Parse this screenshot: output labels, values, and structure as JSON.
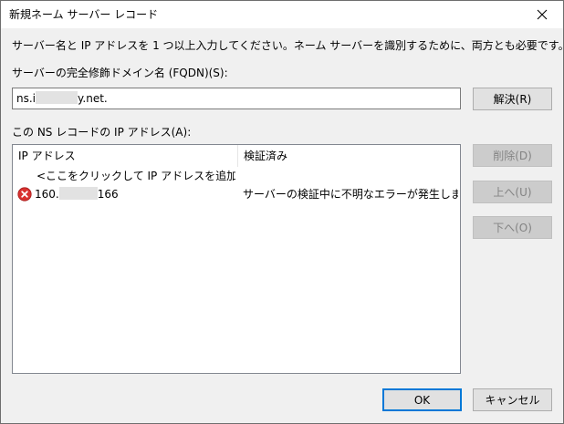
{
  "dialog": {
    "title": "新規ネーム サーバー レコード",
    "close_glyph": "✕"
  },
  "instruction": "サーバー名と IP アドレスを 1 つ以上入力してください。ネーム サーバーを識別するために、両方とも必要です。",
  "fqdn": {
    "label": "サーバーの完全修飾ドメイン名 (FQDN)(S):",
    "value_prefix": "ns.i",
    "value_suffix": "y.net."
  },
  "resolve_button": "解決(R)",
  "ip_section": {
    "label": "この NS レコードの IP アドレス(A):",
    "columns": [
      "IP アドレス",
      "検証済み"
    ],
    "add_prompt": "<ここをクリックして IP アドレスを追加してくださ...",
    "rows": [
      {
        "ip_prefix": "160.",
        "ip_suffix": "166",
        "status": "サーバーの検証中に不明なエラーが発生しました。",
        "icon": "error-icon"
      }
    ]
  },
  "side_buttons": {
    "delete": "削除(D)",
    "up": "上へ(U)",
    "down": "下へ(O)"
  },
  "footer": {
    "ok": "OK",
    "cancel": "キャンセル"
  },
  "colors": {
    "dialog_bg": "#f0f0f0",
    "accent": "#0078d7",
    "error": "#d9312f",
    "disabled_text": "#838383"
  }
}
